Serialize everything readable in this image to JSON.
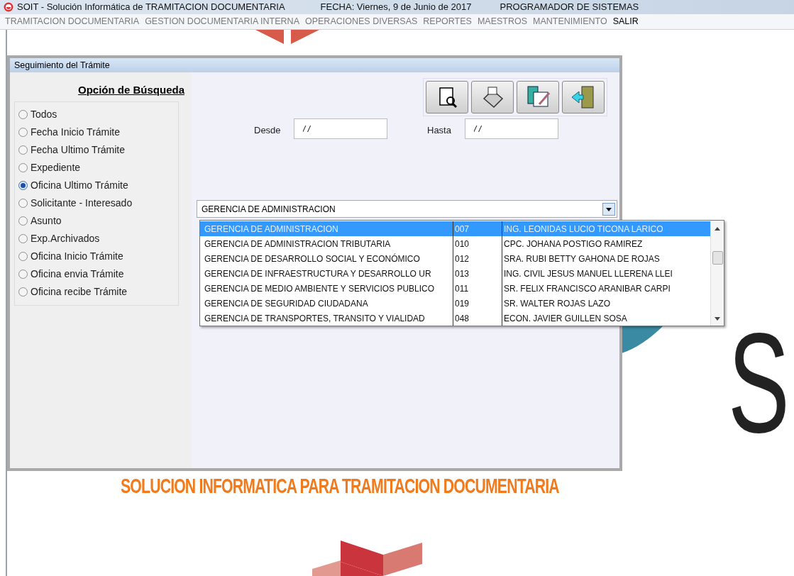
{
  "app_title_bar": {
    "title": "SOIT - Solución Informática de TRAMITACION DOCUMENTARIA",
    "date": "FECHA: Viernes,  9 de Junio de 2017",
    "user": "PROGRAMADOR DE SISTEMAS"
  },
  "menu": [
    {
      "label": "TRAMITACION DOCUMENTARIA",
      "disabled": true
    },
    {
      "label": "GESTION DOCUMENTARIA INTERNA",
      "disabled": true
    },
    {
      "label": "OPERACIONES DIVERSAS",
      "disabled": true
    },
    {
      "label": "REPORTES",
      "disabled": true
    },
    {
      "label": "MAESTROS",
      "disabled": true
    },
    {
      "label": "MANTENIMIENTO",
      "disabled": true
    },
    {
      "label": "SALIR",
      "disabled": false
    }
  ],
  "background": {
    "tagline": "SOLUCION INFORMATICA PARA TRAMITACION DOCUMENTARIA",
    "big_letter": "S"
  },
  "dialog": {
    "title": "Seguimiento del Trámite",
    "search_options": {
      "heading": "Opción de Búsqueda",
      "options": [
        {
          "label": "Todos",
          "selected": false
        },
        {
          "label": "Fecha Inicio Trámite",
          "selected": false
        },
        {
          "label": "Fecha Ultimo Trámite",
          "selected": false
        },
        {
          "label": "Expediente",
          "selected": false
        },
        {
          "label": "Oficina Ultimo Trámite",
          "selected": true
        },
        {
          "label": "Solicitante - Interesado",
          "selected": false
        },
        {
          "label": "Asunto",
          "selected": false
        },
        {
          "label": "Exp.Archivados",
          "selected": false
        },
        {
          "label": "Oficina Inicio Trámite",
          "selected": false
        },
        {
          "label": "Oficina envia Trámite",
          "selected": false
        },
        {
          "label": "Oficina recibe Trámite",
          "selected": false
        }
      ]
    },
    "toolbar": [
      {
        "kind": "preview"
      },
      {
        "kind": "print"
      },
      {
        "kind": "calc"
      },
      {
        "kind": "exit"
      }
    ],
    "desde": {
      "label": "Desde",
      "value": "/ /"
    },
    "hasta": {
      "label": "Hasta",
      "value": "/ /"
    },
    "office_combo": {
      "value": "GERENCIA DE ADMINISTRACION"
    },
    "office_list": [
      {
        "name": "GERENCIA DE ADMINISTRACION",
        "code": "007",
        "head": "ING. LEONIDAS LUCIO TICONA LARICO",
        "selected": true
      },
      {
        "name": "GERENCIA DE ADMINISTRACION TRIBUTARIA",
        "code": "010",
        "head": "CPC. JOHANA POSTIGO RAMIREZ",
        "selected": false
      },
      {
        "name": "GERENCIA DE DESARROLLO SOCIAL Y ECONÓMICO",
        "code": "012",
        "head": "SRA. RUBI BETTY GAHONA DE ROJAS",
        "selected": false
      },
      {
        "name": "GERENCIA DE INFRAESTRUCTURA Y DESARROLLO UR",
        "code": "013",
        "head": "ING. CIVIL JESUS MANUEL LLERENA LLEI",
        "selected": false
      },
      {
        "name": "GERENCIA DE MEDIO AMBIENTE Y SERVICIOS PUBLICO",
        "code": "011",
        "head": "SR. FELIX FRANCISCO ARANIBAR CARPI",
        "selected": false
      },
      {
        "name": "GERENCIA DE SEGURIDAD CIUDADANA",
        "code": "019",
        "head": "SR. WALTER ROJAS LAZO",
        "selected": false
      },
      {
        "name": "GERENCIA DE TRANSPORTES, TRANSITO Y VIALIDAD",
        "code": "048",
        "head": "ECON. JAVIER GUILLEN SOSA",
        "selected": false
      }
    ]
  }
}
